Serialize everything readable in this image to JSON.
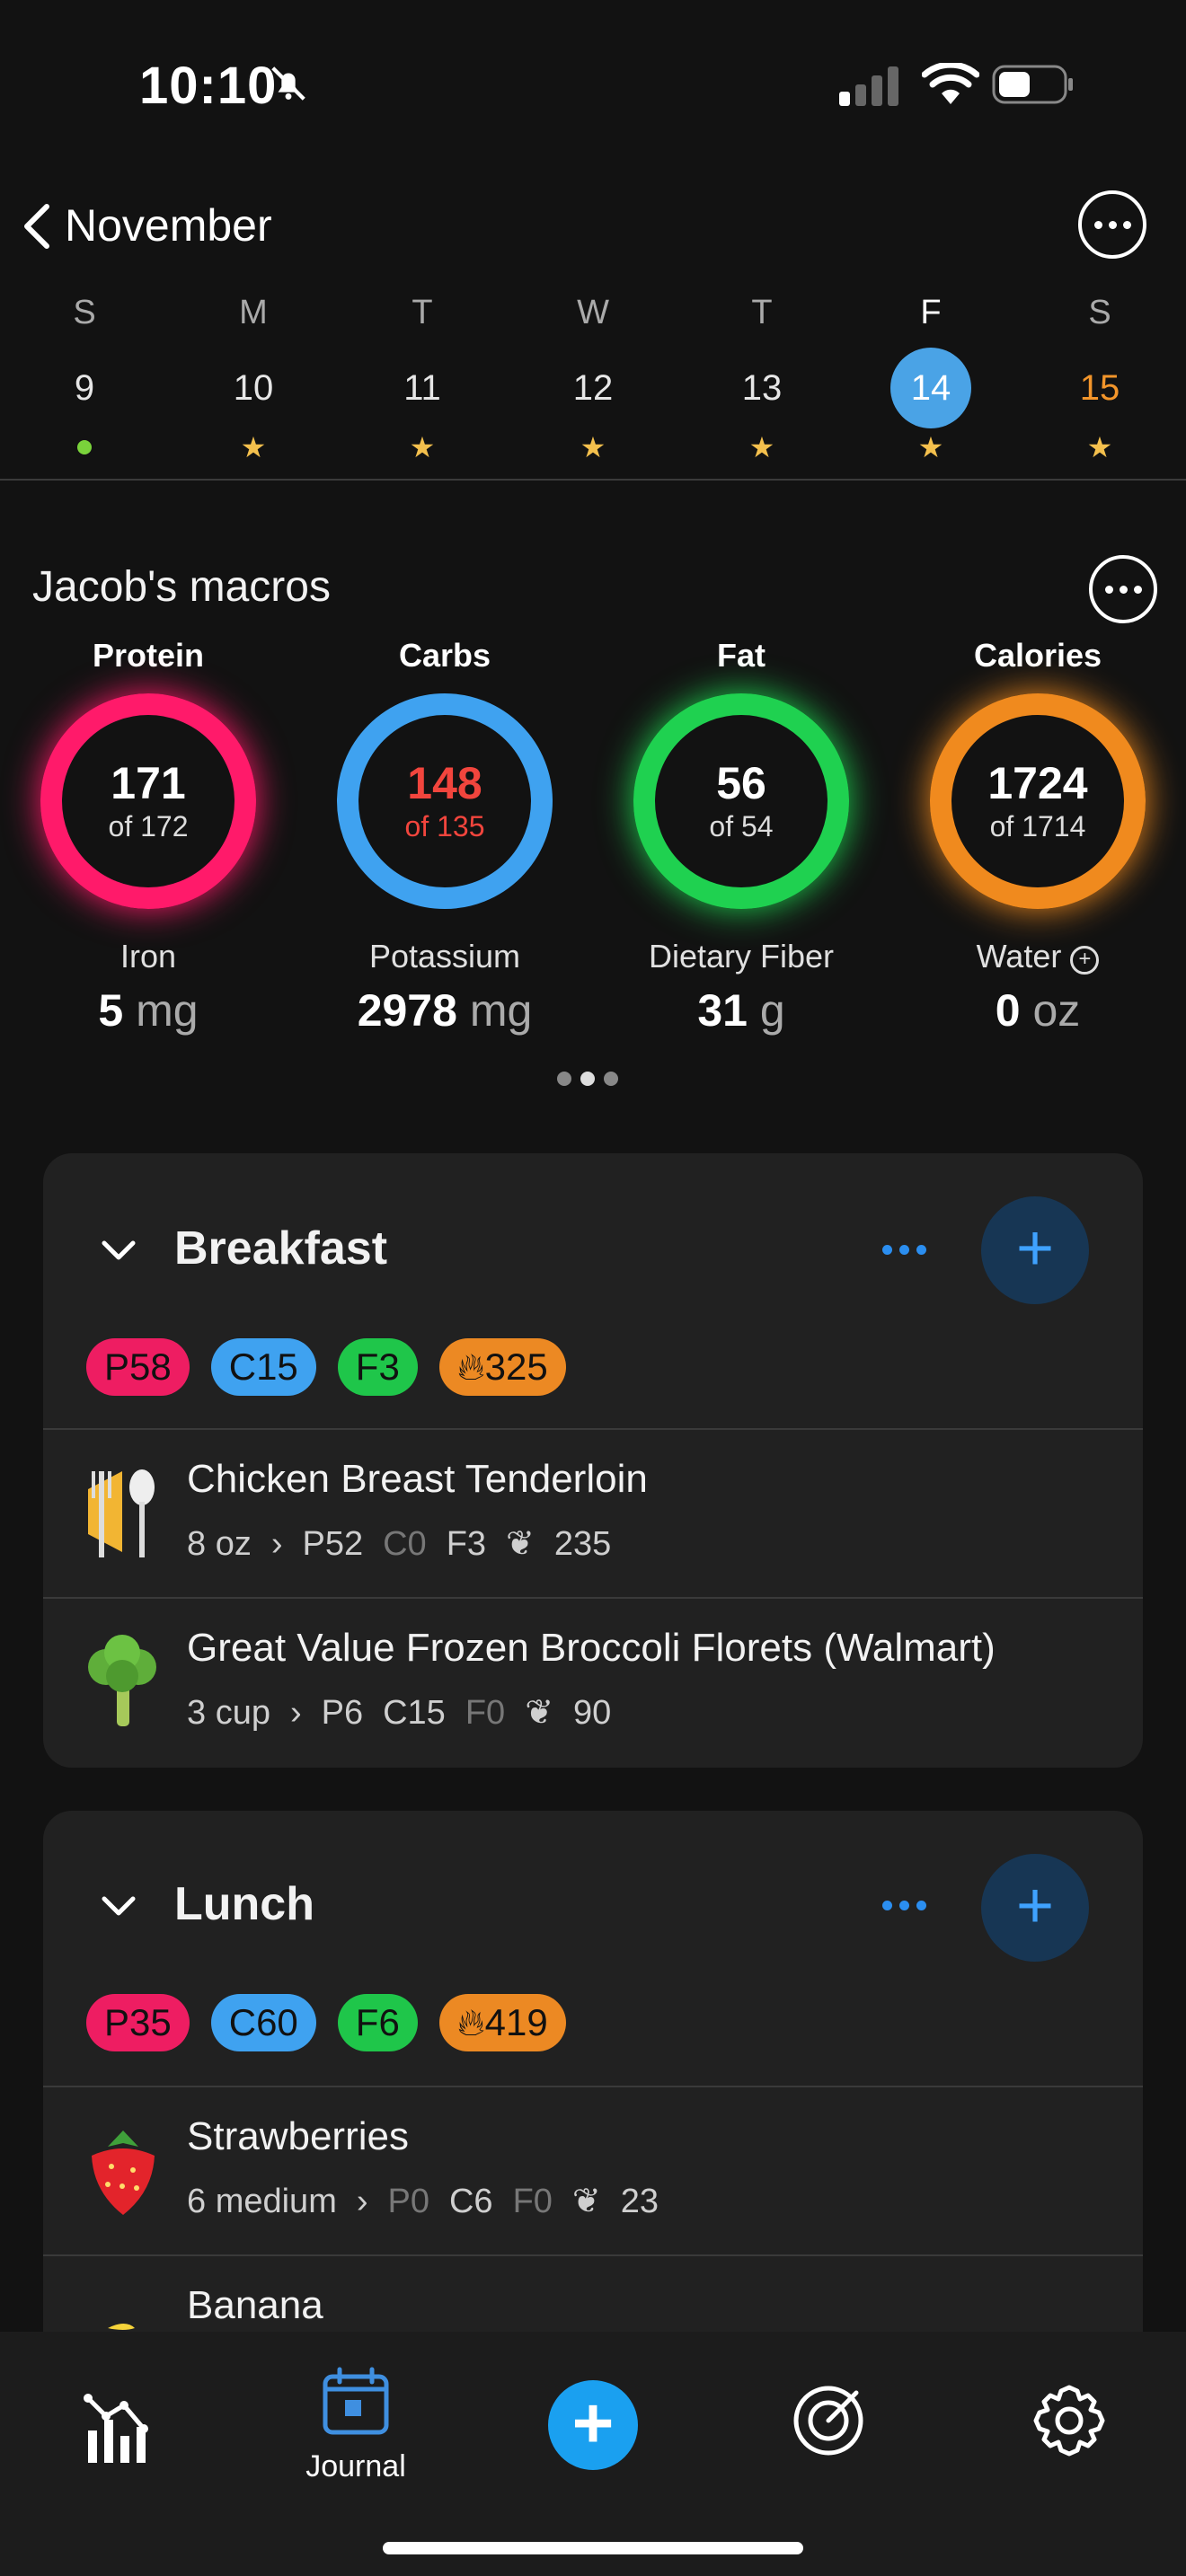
{
  "status_bar": {
    "time": "10:10"
  },
  "header": {
    "month": "November"
  },
  "week": {
    "days": [
      {
        "letter": "S",
        "num": "9",
        "marker": "dot",
        "state": "past"
      },
      {
        "letter": "M",
        "num": "10",
        "marker": "star",
        "state": "past"
      },
      {
        "letter": "T",
        "num": "11",
        "marker": "star",
        "state": "past"
      },
      {
        "letter": "W",
        "num": "12",
        "marker": "star",
        "state": "past"
      },
      {
        "letter": "T",
        "num": "13",
        "marker": "star",
        "state": "past"
      },
      {
        "letter": "F",
        "num": "14",
        "marker": "star",
        "state": "selected"
      },
      {
        "letter": "S",
        "num": "15",
        "marker": "star",
        "state": "future"
      }
    ]
  },
  "macros": {
    "title": "Jacob's macros",
    "rings": [
      {
        "label": "Protein",
        "value": "171",
        "goal": "of 172",
        "color": "#ff1a6a"
      },
      {
        "label": "Carbs",
        "value": "148",
        "goal": "of 135",
        "color": "#3fa2f0"
      },
      {
        "label": "Fat",
        "value": "56",
        "goal": "of 54",
        "color": "#1fd150"
      },
      {
        "label": "Calories",
        "value": "1724",
        "goal": "of 1714",
        "color": "#f08a1e"
      }
    ],
    "nutrients": [
      {
        "label": "Iron",
        "value": "5",
        "unit": "mg"
      },
      {
        "label": "Potassium",
        "value": "2978",
        "unit": "mg"
      },
      {
        "label": "Dietary Fiber",
        "value": "31",
        "unit": "g"
      },
      {
        "label": "Water",
        "value": "0",
        "unit": "oz"
      }
    ]
  },
  "meals": {
    "breakfast": {
      "name": "Breakfast",
      "chips": {
        "p": "P58",
        "c": "C15",
        "f": "F3",
        "k": "325"
      },
      "items": [
        {
          "name": "Chicken Breast Tenderloin",
          "qty": "8 oz",
          "p": "P52",
          "c": "C0",
          "f": "F3",
          "k": "235",
          "icon": "utensils-icon"
        },
        {
          "name": "Great Value Frozen Broccoli Florets (Walmart)",
          "qty": "3 cup",
          "p": "P6",
          "c": "C15",
          "f": "F0",
          "k": "90",
          "icon": "broccoli-icon"
        }
      ]
    },
    "lunch": {
      "name": "Lunch",
      "chips": {
        "p": "P35",
        "c": "C60",
        "f": "F6",
        "k": "419"
      },
      "items": [
        {
          "name": "Strawberries",
          "qty": "6 medium",
          "p": "P0",
          "c": "C6",
          "f": "F0",
          "k": "23",
          "icon": "strawberry-icon"
        },
        {
          "name": "Banana",
          "icon": "banana-icon"
        }
      ]
    }
  },
  "nav": {
    "journal_label": "Journal"
  },
  "colors": {
    "accent": "#1aa0f0",
    "background": "#121212",
    "card": "#212121"
  }
}
